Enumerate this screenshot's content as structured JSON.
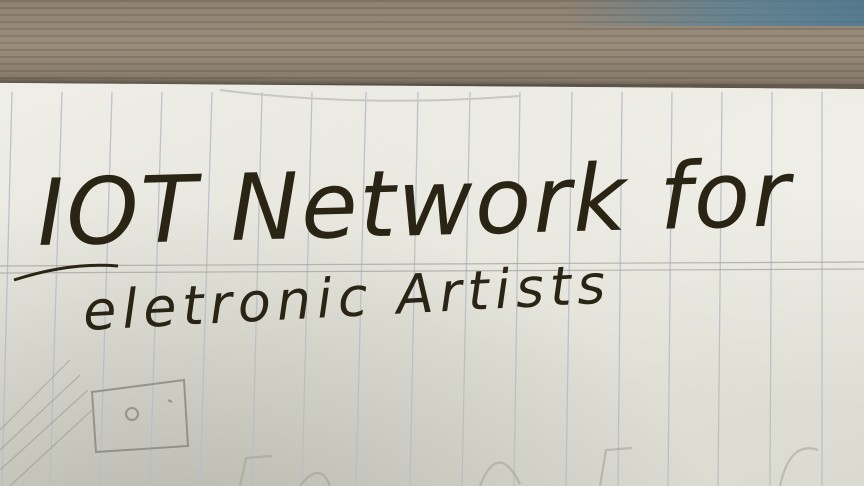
{
  "note": {
    "line1": "IOT Network for",
    "line2": "eletronic Artists"
  },
  "colors": {
    "ink": "#2a2414",
    "paper": "#ecebe3",
    "rule_line": "#b9c0c9",
    "wood": "#8e8273"
  }
}
